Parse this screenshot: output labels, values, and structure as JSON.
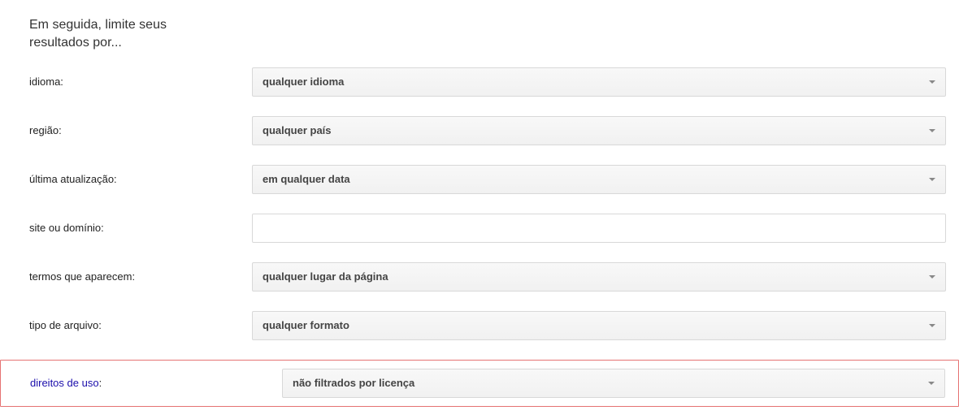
{
  "section_title": "Em seguida, limite seus resultados por...",
  "rows": {
    "language": {
      "label": "idioma:",
      "value": "qualquer idioma"
    },
    "region": {
      "label": "região:",
      "value": "qualquer país"
    },
    "last_update": {
      "label": "última atualização:",
      "value": "em qualquer data"
    },
    "site_domain": {
      "label": "site ou domínio:",
      "value": ""
    },
    "terms_appear": {
      "label": "termos que aparecem:",
      "value": "qualquer lugar da página"
    },
    "file_type": {
      "label": "tipo de arquivo:",
      "value": "qualquer formato"
    },
    "usage_rights": {
      "label_link": "direitos de uso",
      "label_colon": ":",
      "value": "não filtrados por licença"
    }
  }
}
